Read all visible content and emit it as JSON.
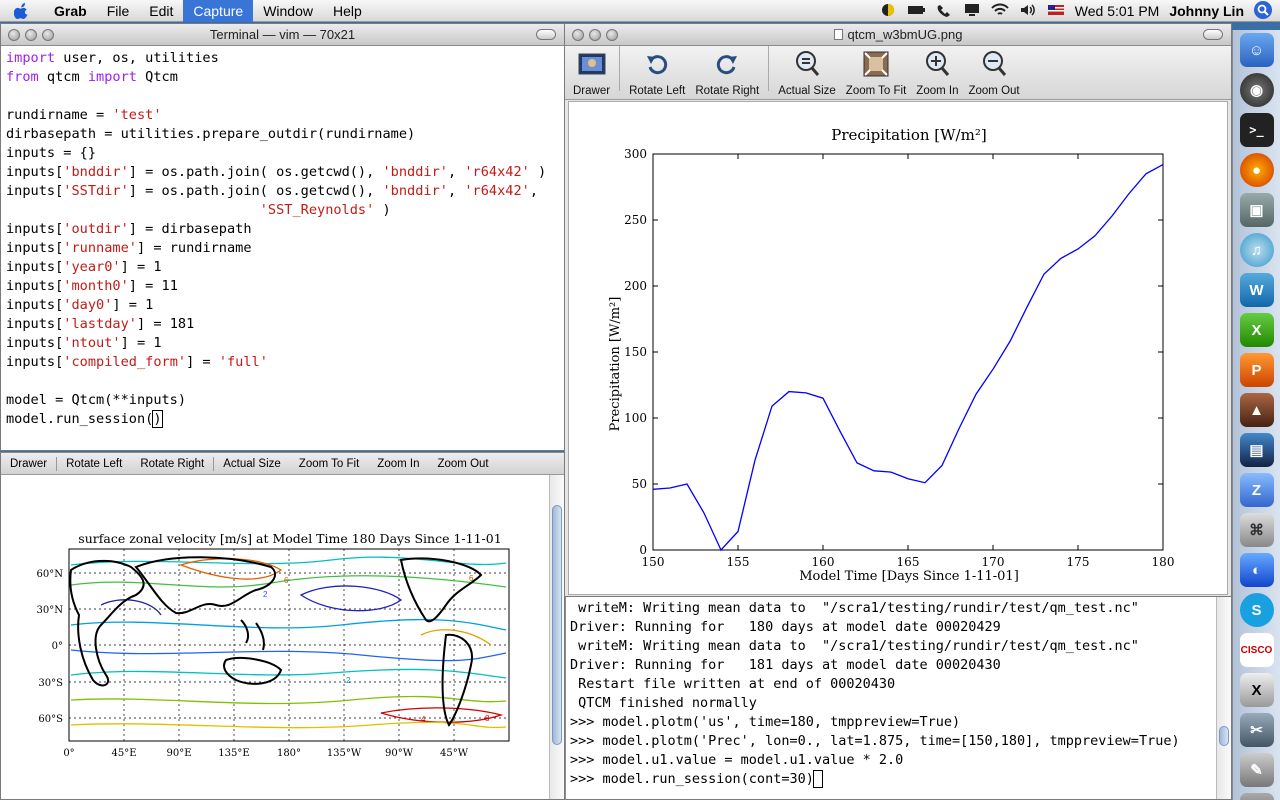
{
  "menubar": {
    "app": "Grab",
    "items": [
      "File",
      "Edit",
      "Capture",
      "Window",
      "Help"
    ],
    "active": "Capture",
    "clock": "Wed 5:01 PM",
    "user": "Johnny Lin"
  },
  "terminal": {
    "title": "Terminal — vim — 70x21"
  },
  "preview2": {
    "toolbar": [
      "Drawer",
      "Rotate Left",
      "Rotate Right",
      "Actual Size",
      "Zoom To Fit",
      "Zoom In",
      "Zoom Out"
    ],
    "map_title": "surface zonal velocity [m/s] at Model Time 180 Days Since 1-11-01",
    "lat_labels": [
      "60°N",
      "30°N",
      "0°",
      "30°S",
      "60°S"
    ],
    "lon_labels": [
      "0°",
      "45°E",
      "90°E",
      "135°E",
      "180°",
      "135°W",
      "90°W",
      "45°W"
    ],
    "contour_labels": [
      "6",
      "2",
      "6",
      "8",
      "4",
      "2"
    ]
  },
  "viewer": {
    "title": "qtcm_w3bmUG.png",
    "tools": [
      "Drawer",
      "Rotate Left",
      "Rotate Right",
      "Actual Size",
      "Zoom To Fit",
      "Zoom In",
      "Zoom Out"
    ]
  },
  "chart_data": {
    "type": "line",
    "title": "Precipitation [W/m²]",
    "xlabel": "Model Time [Days Since 1-11-01]",
    "ylabel": "Precipitation [W/m²]",
    "xlim": [
      150,
      180
    ],
    "ylim": [
      0,
      300
    ],
    "xticks": [
      150,
      155,
      160,
      165,
      170,
      175,
      180
    ],
    "yticks": [
      0,
      50,
      100,
      150,
      200,
      250,
      300
    ],
    "color": "#0000ff",
    "x": [
      150,
      151,
      152,
      153,
      154,
      155,
      156,
      157,
      158,
      159,
      160,
      161,
      162,
      163,
      164,
      165,
      166,
      167,
      168,
      169,
      170,
      171,
      172,
      173,
      174,
      175,
      176,
      177,
      178,
      179,
      180
    ],
    "y": [
      46,
      47,
      50,
      28,
      0,
      14,
      68,
      109,
      120,
      119,
      115,
      90,
      66,
      60,
      59,
      54,
      51,
      64,
      92,
      118,
      137,
      158,
      184,
      209,
      221,
      228,
      238,
      253,
      270,
      285,
      292
    ]
  },
  "pyterm": {
    "lines": [
      " writeM: Writing mean data to  \"/scra1/testing/rundir/test/qm_test.nc\"",
      "Driver: Running for   180 days at model date 00020429",
      " writeM: Writing mean data to  \"/scra1/testing/rundir/test/qm_test.nc\"",
      "Driver: Running for   181 days at model date 00020430",
      " Restart file written at end of 00020430",
      " QTCM finished normally",
      ">>> model.plotm('us', time=180, tmppreview=True)",
      ">>> model.plotm('Prec', lon=0., lat=1.875, time=[150,180], tmppreview=True)",
      ">>> model.u1.value = model.u1.value * 2.0",
      ">>> model.run_session(cont=30)"
    ]
  }
}
